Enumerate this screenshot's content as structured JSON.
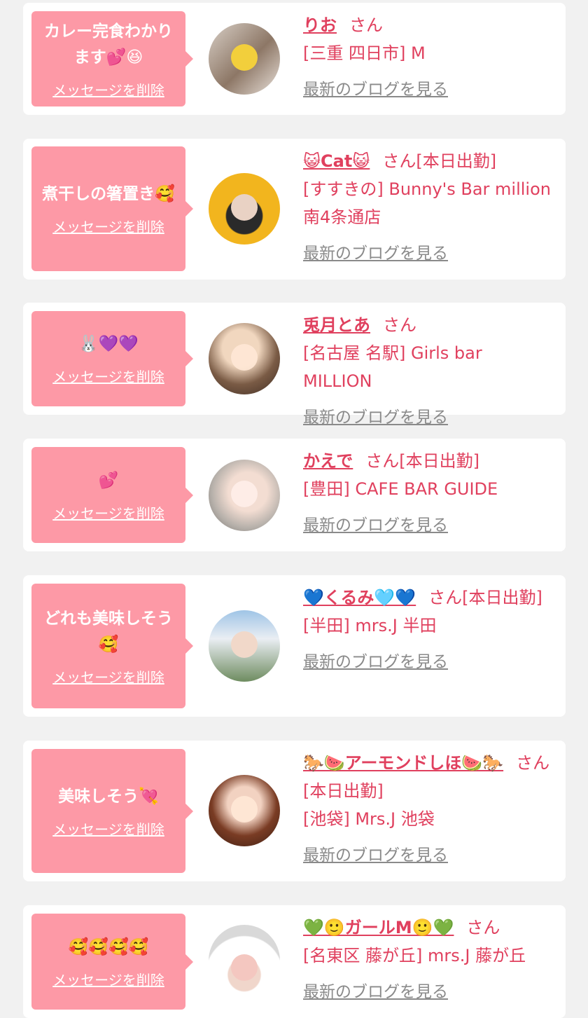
{
  "accent_color": "#e0405e",
  "bubble_color": "#fd99a6",
  "entries": [
    {
      "message": "カレー完食わかります💕😆",
      "delete_label": "メッセージを削除",
      "name": "りお",
      "suffix": "さん",
      "location": "[三重 四日市] M",
      "blog_link": "最新のブログを見る",
      "avatar_icon": "profile-photo"
    },
    {
      "message": "煮干しの箸置き🥰",
      "delete_label": "メッセージを削除",
      "name": "😺Cat😺",
      "suffix": "さん[本日出勤]",
      "location": "[すすきの] Bunny's Bar million 南4条通店",
      "blog_link": "最新のブログを見る",
      "avatar_icon": "profile-photo"
    },
    {
      "message": "🐰💜💜",
      "delete_label": "メッセージを削除",
      "name": "兎月とあ",
      "suffix": "さん",
      "location": "[名古屋 名駅] Girls bar MILLION",
      "blog_link": "最新のブログを見る",
      "avatar_icon": "profile-photo"
    },
    {
      "message": "💕",
      "delete_label": "メッセージを削除",
      "name": "かえで",
      "suffix": "さん[本日出勤]",
      "location": "[豊田] CAFE BAR GUIDE",
      "blog_link": "最新のブログを見る",
      "avatar_icon": "profile-photo"
    },
    {
      "message": "どれも美味しそう🥰",
      "delete_label": "メッセージを削除",
      "name": "💙くるみ🩵💙",
      "suffix": "さん[本日出勤]",
      "location": "[半田] mrs.J 半田",
      "blog_link": "最新のブログを見る",
      "avatar_icon": "profile-photo"
    },
    {
      "message": "美味しそう💘",
      "delete_label": "メッセージを削除",
      "name": "🐎🍉アーモンドしほ🍉🐎",
      "suffix": "さん[本日出勤]",
      "location": "[池袋] Mrs.J 池袋",
      "blog_link": "最新のブログを見る",
      "avatar_icon": "profile-photo"
    },
    {
      "message": "🥰🥰🥰🥰",
      "delete_label": "メッセージを削除",
      "name": "💚🙂ガールM🙂💚",
      "suffix": "さん",
      "location": "[名東区 藤が丘] mrs.J 藤が丘",
      "blog_link": "最新のブログを見る",
      "avatar_icon": "profile-photo"
    }
  ]
}
